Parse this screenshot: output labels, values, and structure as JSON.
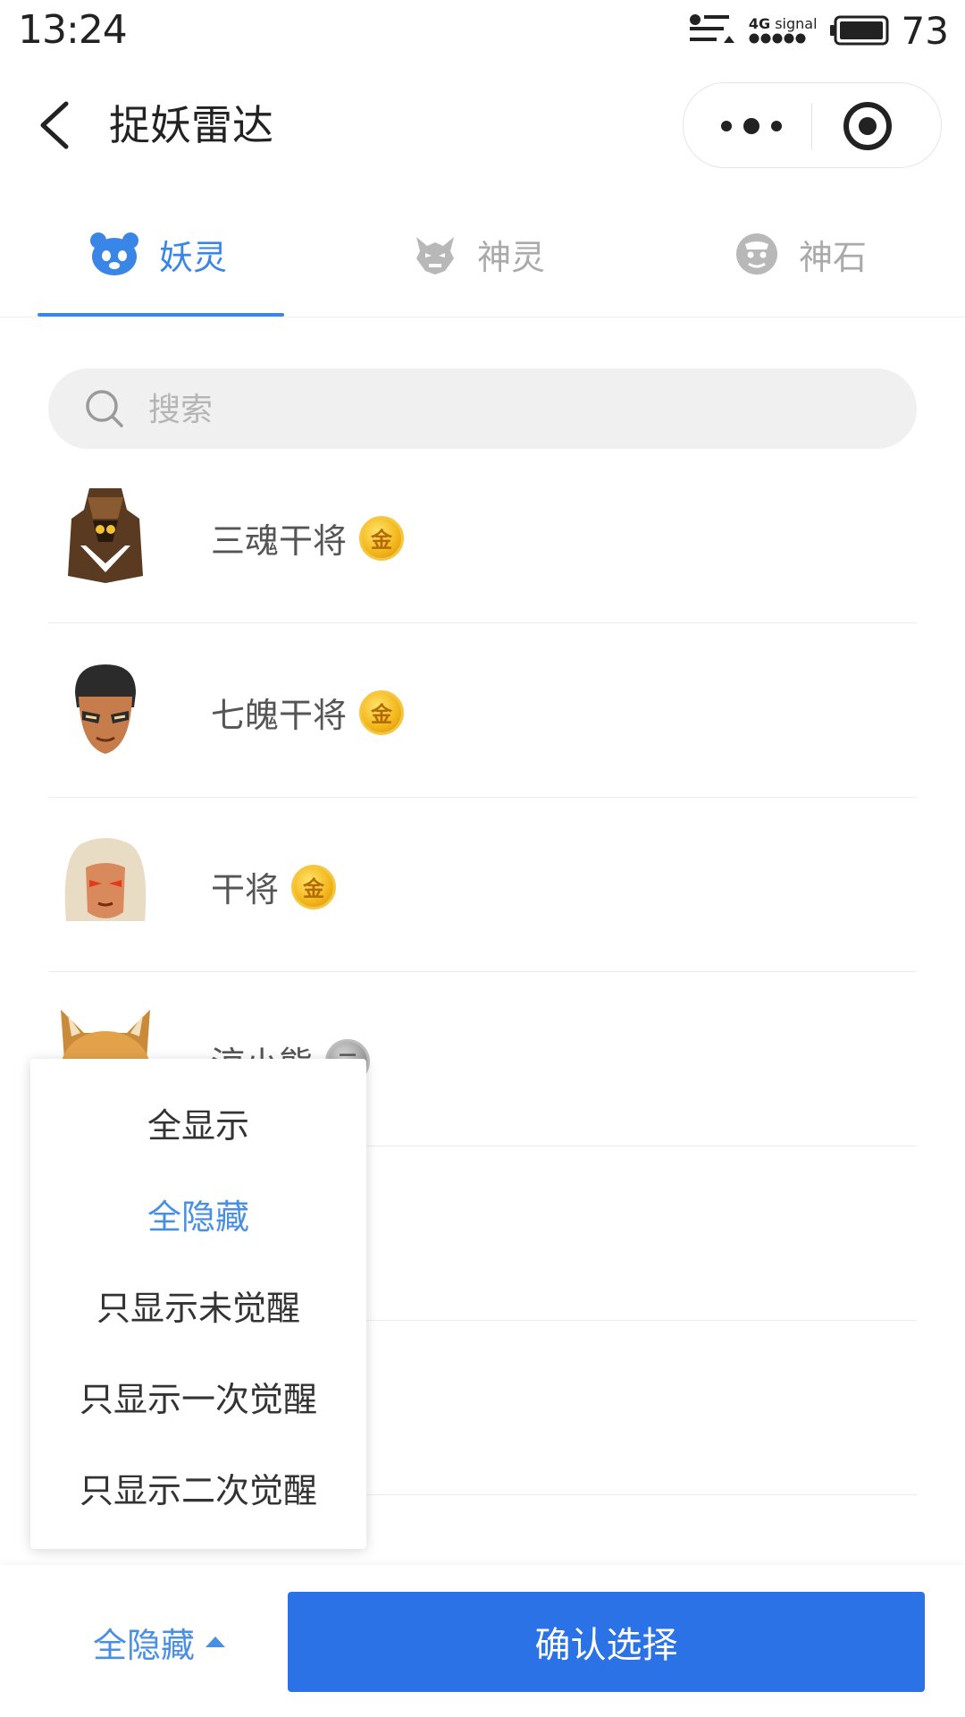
{
  "status_bar": {
    "time": "13:24",
    "network_label": "4G",
    "signal_label": "signal",
    "battery_percent": "73"
  },
  "navbar": {
    "title": "捉妖雷达"
  },
  "tabs": [
    {
      "label": "妖灵",
      "active": true,
      "icon": "panda-face-icon"
    },
    {
      "label": "神灵",
      "active": false,
      "icon": "demon-mask-icon"
    },
    {
      "label": "神石",
      "active": false,
      "icon": "stone-face-icon"
    }
  ],
  "search": {
    "placeholder": "搜索"
  },
  "list": {
    "items": [
      {
        "name": "三魂干将",
        "grade": "金",
        "grade_color": "gold"
      },
      {
        "name": "七魄干将",
        "grade": "金",
        "grade_color": "gold"
      },
      {
        "name": "干将",
        "grade": "金",
        "grade_color": "gold"
      },
      {
        "name": "涼小熊",
        "grade": "元",
        "grade_color": "silver"
      }
    ]
  },
  "dropdown": {
    "options": [
      "全显示",
      "全隐藏",
      "只显示未觉醒",
      "只显示一次觉醒",
      "只显示二次觉醒"
    ],
    "selected": "全隐藏"
  },
  "bottom_bar": {
    "filter_label": "全隐藏",
    "confirm_label": "确认选择"
  },
  "colors": {
    "accent": "#3a86e6",
    "primary_button": "#2b72e6",
    "gold": "#f2b51a",
    "silver": "#9a9a9a"
  }
}
